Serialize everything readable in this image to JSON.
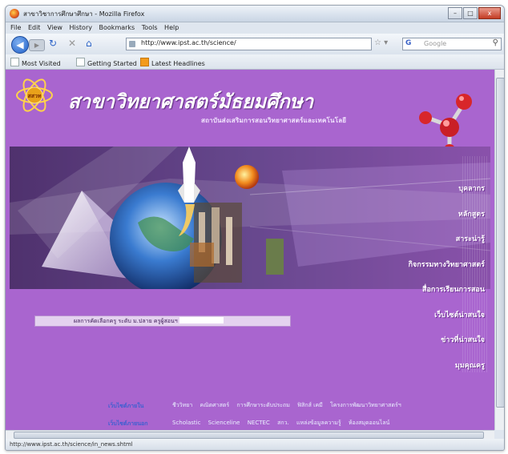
{
  "window": {
    "title": "สาขาวิชาการศึกษาศึกษา - Mozilla Firefox",
    "buttons": [
      "–",
      "□",
      "x"
    ]
  },
  "menubar": [
    "File",
    "Edit",
    "View",
    "History",
    "Bookmarks",
    "Tools",
    "Help"
  ],
  "navbar": {
    "url": "http://www.ipst.ac.th/science/",
    "search_placeholder": "Google",
    "search_engine_glyph": "G"
  },
  "bookmarks": [
    "Most Visited",
    "Getting Started",
    "Latest Headlines"
  ],
  "page": {
    "department": "สาขาวิทยาศาสตร์มัธยมศึกษา",
    "institute": "สถาบันส่งเสริมการสอนวิทยาศาสตร์และเทคโนโลยี",
    "logo_text": "สสวท",
    "menu": [
      "บุคลากร",
      "หลักสูตร",
      "สาระน่ารู้",
      "กิจกรรมทางวิทยาศาสตร์",
      "สื่อการเรียนการสอน",
      "เว็บไซต์น่าสนใจ",
      "ข่าวที่น่าสนใจ",
      "มุมคุณครู"
    ],
    "ticker": "ผลการคัดเลือกครู ระดับ ม.ปลาย ครูผู้สอนฯ",
    "footer": [
      {
        "label": "เว็บไซต์ภายใน",
        "links": [
          "ชีววิทยา",
          "คณิตศาสตร์",
          "การศึกษาระดับประถม",
          "ฟิสิกส์ เคมี",
          "โครงการพัฒนาวิทยาศาสตร์ฯ"
        ]
      },
      {
        "label": "เว็บไซต์ภายนอก",
        "links": [
          "Scholastic",
          "Scienceline",
          "NECTEC",
          "สกว.",
          "แหล่งข้อมูลความรู้",
          "ห้องสมุดออนไลน์"
        ]
      }
    ]
  },
  "statusbar": "http://www.ipst.ac.th/science/in_news.shtml",
  "colors": {
    "page_bg": "#a965cf",
    "link_blue": "#3d5fd0"
  }
}
